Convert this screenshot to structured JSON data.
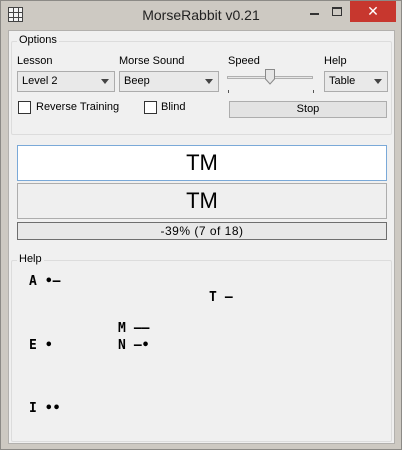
{
  "window": {
    "title": "MorseRabbit v0.21",
    "close_glyph": "✕"
  },
  "options": {
    "group_title": "Options",
    "lesson": {
      "label": "Lesson",
      "value": "Level 2"
    },
    "sound": {
      "label": "Morse Sound",
      "value": "Beep"
    },
    "speed": {
      "label": "Speed",
      "level_fraction": 0.5
    },
    "help": {
      "label": "Help",
      "value": "Table"
    },
    "reverse_training_label": "Reverse Training",
    "blind_label": "Blind",
    "stop_label": "Stop"
  },
  "display": {
    "target_text": "TM",
    "input_text": "TM",
    "progress_text": "-39%    (7 of 18)"
  },
  "help": {
    "group_title": "Help",
    "rows": [
      {
        "letter": "A",
        "code": "•–"
      },
      {
        "letter": "T",
        "code": "–"
      },
      {
        "letter": "M",
        "code": "––"
      },
      {
        "letter": "E",
        "code": "•"
      },
      {
        "letter": "N",
        "code": "–•"
      },
      {
        "letter": "I",
        "code": "••"
      }
    ]
  }
}
